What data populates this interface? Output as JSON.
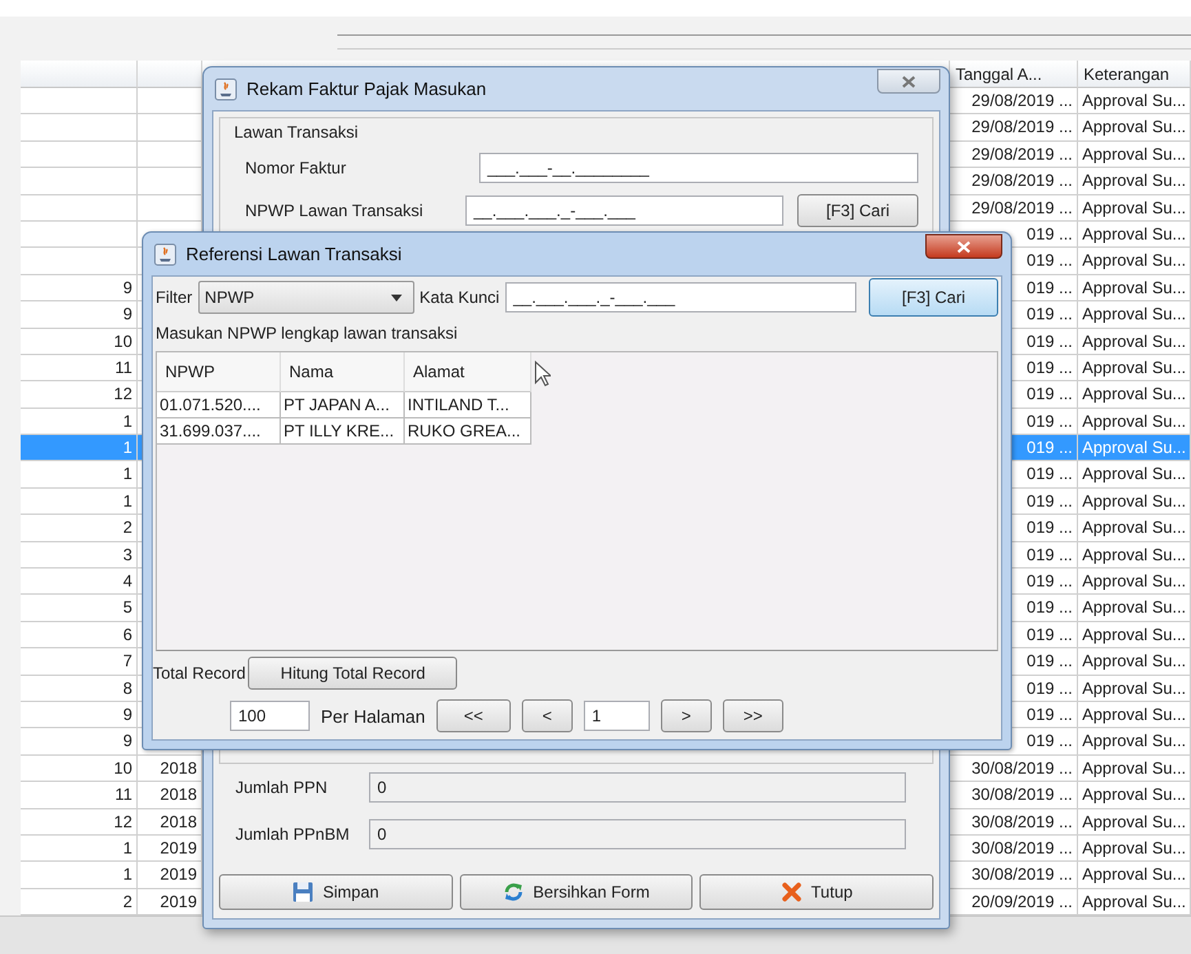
{
  "main_table": {
    "columns": [
      "Tanggal A...",
      "Keterangan"
    ],
    "rows": [
      {
        "tanggal": "29/08/2019 ...",
        "keterangan": "Approval Su...",
        "selected": false
      },
      {
        "tanggal": "29/08/2019 ...",
        "keterangan": "Approval Su...",
        "selected": false
      },
      {
        "tanggal": "29/08/2019 ...",
        "keterangan": "Approval Su...",
        "selected": false
      },
      {
        "tanggal": "29/08/2019 ...",
        "keterangan": "Approval Su...",
        "selected": false
      },
      {
        "tanggal": "29/08/2019 ...",
        "keterangan": "Approval Su...",
        "selected": false
      },
      {
        "tanggal": "019 ...",
        "keterangan": "Approval Su...",
        "selected": false
      },
      {
        "tanggal": "019 ...",
        "keterangan": "Approval Su...",
        "selected": false
      },
      {
        "column_1": "9",
        "tanggal": "019 ...",
        "keterangan": "Approval Su...",
        "selected": false
      },
      {
        "column_1": "9",
        "tanggal": "019 ...",
        "keterangan": "Approval Su...",
        "selected": false
      },
      {
        "column_1": "10",
        "tanggal": "019 ...",
        "keterangan": "Approval Su...",
        "selected": false
      },
      {
        "column_1": "11",
        "tanggal": "019 ...",
        "keterangan": "Approval Su...",
        "selected": false
      },
      {
        "column_1": "12",
        "tanggal": "019 ...",
        "keterangan": "Approval Su...",
        "selected": false
      },
      {
        "column_1": "1",
        "tanggal": "019 ...",
        "keterangan": "Approval Su...",
        "selected": false
      },
      {
        "column_1": "1",
        "tanggal": "019 ...",
        "keterangan": "Approval Su...",
        "selected": true
      },
      {
        "column_1": "1",
        "tanggal": "019 ...",
        "keterangan": "Approval Su...",
        "selected": false
      },
      {
        "column_1": "1",
        "tanggal": "019 ...",
        "keterangan": "Approval Su...",
        "selected": false
      },
      {
        "column_1": "2",
        "tanggal": "019 ...",
        "keterangan": "Approval Su...",
        "selected": false
      },
      {
        "column_1": "3",
        "tanggal": "019 ...",
        "keterangan": "Approval Su...",
        "selected": false
      },
      {
        "column_1": "4",
        "tanggal": "019 ...",
        "keterangan": "Approval Su...",
        "selected": false
      },
      {
        "column_1": "5",
        "tanggal": "019 ...",
        "keterangan": "Approval Su...",
        "selected": false
      },
      {
        "column_1": "6",
        "tanggal": "019 ...",
        "keterangan": "Approval Su...",
        "selected": false
      },
      {
        "column_1": "7",
        "tanggal": "019 ...",
        "keterangan": "Approval Su...",
        "selected": false
      },
      {
        "column_1": "8",
        "tanggal": "019 ...",
        "keterangan": "Approval Su...",
        "selected": false
      },
      {
        "column_1": "9",
        "tanggal": "019 ...",
        "keterangan": "Approval Su...",
        "selected": false
      },
      {
        "column_1": "9",
        "tanggal": "019 ...",
        "keterangan": "Approval Su...",
        "selected": false
      },
      {
        "column_1": "10",
        "column_2": "2018",
        "tanggal": "30/08/2019 ...",
        "keterangan": "Approval Su...",
        "selected": false
      },
      {
        "column_1": "11",
        "column_2": "2018",
        "tanggal": "30/08/2019 ...",
        "keterangan": "Approval Su...",
        "selected": false
      },
      {
        "column_1": "12",
        "column_2": "2018",
        "tanggal": "30/08/2019 ...",
        "keterangan": "Approval Su...",
        "selected": false
      },
      {
        "column_1": "1",
        "column_2": "2019",
        "tanggal": "30/08/2019 ...",
        "keterangan": "Approval Su...",
        "selected": false
      },
      {
        "column_1": "1",
        "column_2": "2019",
        "tanggal": "30/08/2019 ...",
        "keterangan": "Approval Su...",
        "selected": false
      },
      {
        "column_1": "2",
        "column_2": "2019",
        "tanggal": "20/09/2019 ...",
        "keterangan": "Approval Su...",
        "selected": false
      }
    ]
  },
  "rekam_dialog": {
    "title": "Rekam Faktur Pajak Masukan",
    "active": false,
    "group_label": "Lawan Transaksi",
    "fields": [
      {
        "label": "Nomor Faktur",
        "value": "___.___-__.________"
      },
      {
        "label": "NPWP Lawan Transaksi",
        "value": "__.___.___._-___.___",
        "button": "[F3] Cari"
      }
    ],
    "amounts": [
      {
        "label": "Jumlah PPN",
        "value": "0"
      },
      {
        "label": "Jumlah PPnBM",
        "value": "0"
      }
    ],
    "buttons": [
      "Simpan",
      "Bersihkan Form",
      "Tutup"
    ]
  },
  "referensi_dialog": {
    "title": "Referensi Lawan Transaksi",
    "active": true,
    "filter_label": "Filter",
    "filter_value": "NPWP",
    "keyword_label": "Kata Kunci",
    "keyword_value": "__.___.___._-___.___",
    "search_button": "[F3] Cari",
    "hint": "Masukan NPWP lengkap lawan transaksi",
    "table": {
      "columns": [
        "NPWP",
        "Nama",
        "Alamat"
      ],
      "rows": [
        [
          "01.071.520....",
          "PT JAPAN A...",
          "INTILAND T..."
        ],
        [
          "31.699.037....",
          "PT ILLY KRE...",
          "RUKO GREA..."
        ]
      ]
    },
    "total_label": "Total Record",
    "total_button": "Hitung Total Record",
    "page_size": "100",
    "page_size_label": "Per Halaman",
    "nav_before": [
      "<<",
      "<"
    ],
    "page": "1",
    "nav_after": [
      ">",
      ">>"
    ]
  }
}
